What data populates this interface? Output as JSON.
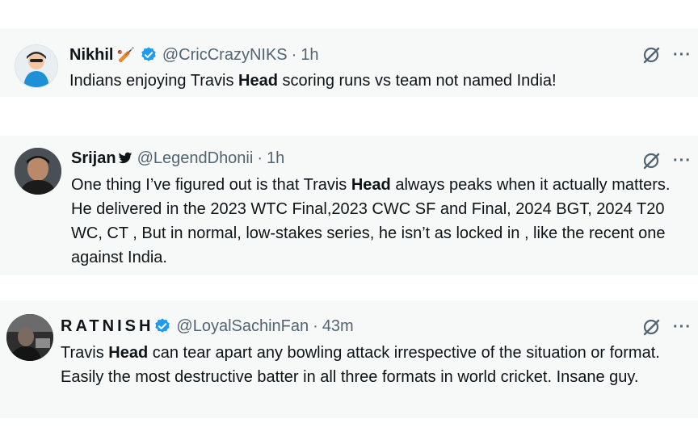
{
  "tweets": [
    {
      "name": "Nikhil",
      "name_emoji": "🏏",
      "verified": true,
      "handle": "@CricCrazyNIKS",
      "sep": "·",
      "time": "1h",
      "text_before": "Indians enjoying Travis ",
      "highlight": "Head",
      "text_after": " scoring runs vs team not named India!"
    },
    {
      "name": "Srijan",
      "name_emoji": "🐦",
      "verified": false,
      "handle": "@LegendDhonii",
      "sep": "·",
      "time": "1h",
      "text_before": "One thing I’ve figured out is that Travis ",
      "highlight": "Head",
      "text_after": " always peaks when it actually matters. He delivered in the 2023 WTC Final,2023 CWC SF and Final, 2024 BGT, 2024 T20 WC, CT , But in normal, low-stakes series, he isn’t as locked in , like the recent one against India."
    },
    {
      "name": "RATNISH",
      "verified": true,
      "handle": "@LoyalSachinFan",
      "sep": "·",
      "time": "43m",
      "text_before": "Travis ",
      "highlight": "Head",
      "text_after": " can tear apart any bowling attack irrespective of the situation or format. Easily the most destructive batter in all three formats in world cricket. Insane guy."
    }
  ],
  "icons": {
    "verified": "verified-badge-icon",
    "grok": "grok-icon",
    "more": "more-icon",
    "more_glyph": "···"
  },
  "colors": {
    "verified_blue": "#1d9bf0",
    "secondary_text": "#536471",
    "card_background": "#f7f8f8"
  }
}
